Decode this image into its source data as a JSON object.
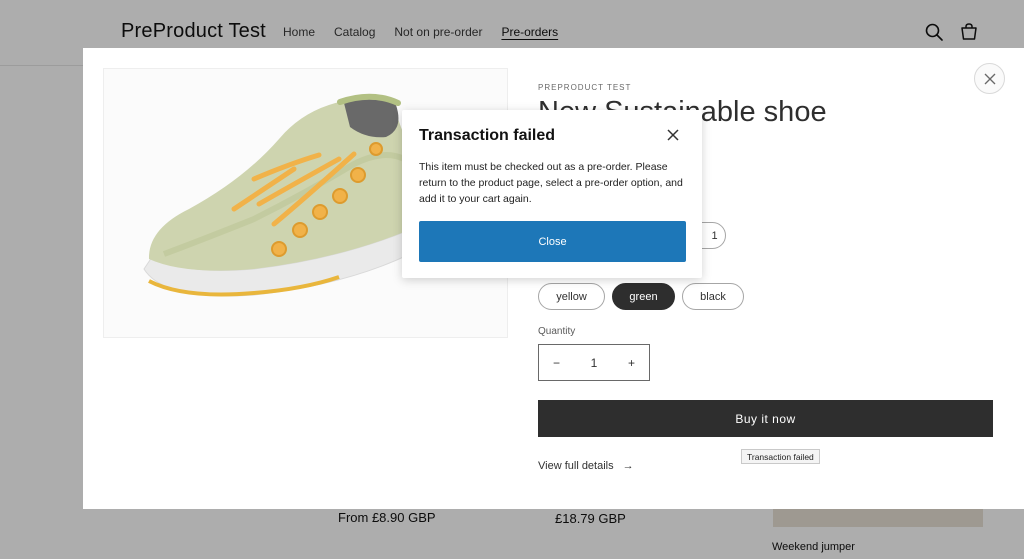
{
  "header": {
    "logo": "PreProduct Test",
    "nav": [
      "Home",
      "Catalog",
      "Not on pre-order",
      "Pre-orders"
    ],
    "active_nav": "Pre-orders",
    "icons": [
      "search-icon",
      "cart-icon"
    ]
  },
  "page": {
    "price_1": "From £8.90 GBP",
    "price_2": "£18.79 GBP",
    "product_3": "Weekend jumper"
  },
  "quick_view": {
    "vendor": "PREPRODUCT TEST",
    "title": "New Sustainable shoe",
    "size_option_partial": "1",
    "colors": [
      "yellow",
      "green",
      "black"
    ],
    "selected_color": "green",
    "quantity_label": "Quantity",
    "quantity_value": "1",
    "decrease_symbol": "−",
    "increase_symbol": "+",
    "buy_label": "Buy it now",
    "details_label": "View full details",
    "details_arrow": "→"
  },
  "dialog": {
    "title": "Transaction failed",
    "message": "This item must be checked out as a pre-order. Please return to the product page, select a pre-order option, and add it to your cart again.",
    "button_label": "Close"
  },
  "tooltip": {
    "text": "Transaction failed"
  },
  "colors": {
    "accent_button": "#1d77b8",
    "buy_button": "#121212",
    "selected_pill": "#121212"
  }
}
